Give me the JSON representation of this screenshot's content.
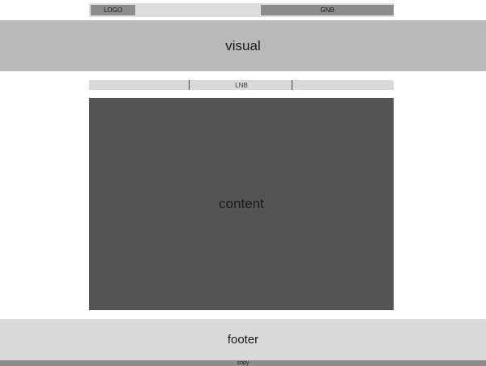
{
  "header": {
    "logo": "LOGO",
    "gnb": "GNB"
  },
  "visual": "visual",
  "lnb": "LNB",
  "content": "content",
  "footer": "footer",
  "copy": "copy",
  "colors": {
    "background": "#ffffff",
    "header_bar": "#dcdcdc",
    "logo_gnb": "#8c8c8c",
    "visual": "#b9b9b9",
    "lnb": "#d9d9d9",
    "content": "#545454",
    "footer": "#d9d9d9",
    "copy": "#8c8c8c"
  }
}
